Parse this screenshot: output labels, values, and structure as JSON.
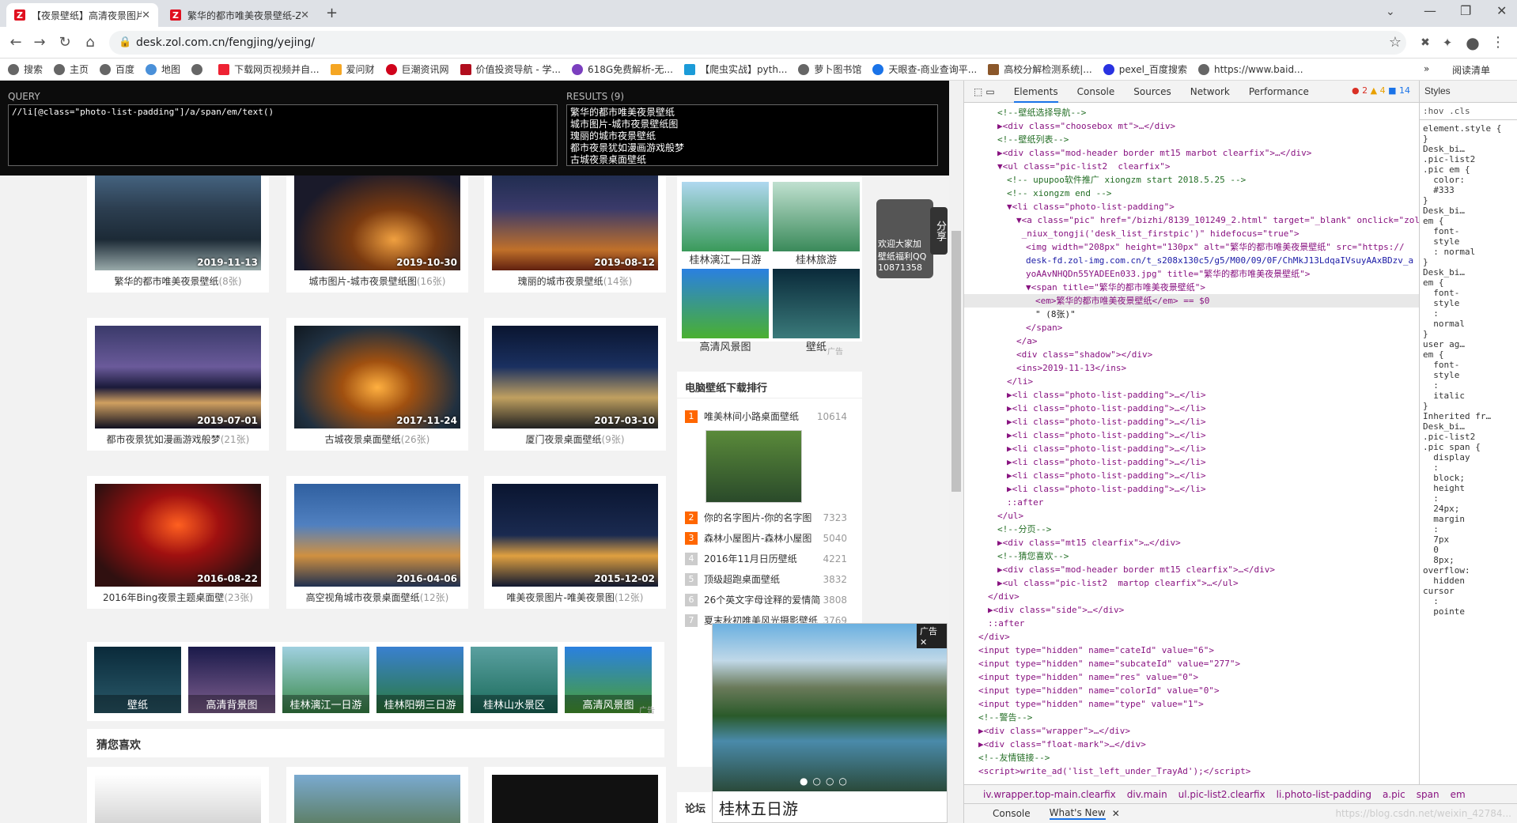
{
  "tabs": [
    {
      "title": "【夜景壁纸】高清夜景图片-ZOL",
      "active": true
    },
    {
      "title": "繁华的都市唯美夜景壁纸-ZOL桌",
      "active": false
    }
  ],
  "address": {
    "url": "desk.zol.com.cn/fengjing/yejing/"
  },
  "bookmarks": [
    "搜索",
    "主页",
    "百度",
    "地图",
    "",
    "下载网页视频并自...",
    "爱问财",
    "巨潮资讯网",
    "价值投资导航 - 学...",
    "618G免费解析-无...",
    "【爬虫实战】pyth...",
    "萝卜图书馆",
    "天眼查-商业查询平...",
    "高校分解检测系统|...",
    "pexel_百度搜索",
    "https://www.baid..."
  ],
  "bookmarks_more": "»",
  "reading_list": "阅读清单",
  "xpath_helper": {
    "query_label": "QUERY",
    "query": "//li[@class=\"photo-list-padding\"]/a/span/em/text()",
    "results_label": "RESULTS (9)",
    "results": [
      "繁华的都市唯美夜景壁纸",
      "城市图片-城市夜景壁纸图",
      "瑰丽的城市夜景壁纸",
      "都市夜景犹如漫画游戏般梦",
      "古城夜景桌面壁纸"
    ]
  },
  "photos": [
    {
      "title": "繁华的都市唯美夜景壁纸",
      "count": "(8张)",
      "date": "2019-11-13"
    },
    {
      "title": "城市图片-城市夜景壁纸图",
      "count": "(16张)",
      "date": "2019-10-30"
    },
    {
      "title": "瑰丽的城市夜景壁纸",
      "count": "(14张)",
      "date": "2019-08-12"
    },
    {
      "title": "都市夜景犹如漫画游戏般梦",
      "count": "(21张)",
      "date": "2019-07-01"
    },
    {
      "title": "古城夜景桌面壁纸",
      "count": "(26张)",
      "date": "2017-11-24"
    },
    {
      "title": "厦门夜景桌面壁纸",
      "count": "(9张)",
      "date": "2017-03-10"
    },
    {
      "title": "2016年Bing夜景主题桌面壁",
      "count": "(23张)",
      "date": "2016-08-22"
    },
    {
      "title": "高空视角城市夜景桌面壁纸",
      "count": "(12张)",
      "date": "2016-04-06"
    },
    {
      "title": "唯美夜景图片-唯美夜景图",
      "count": "(12张)",
      "date": "2015-12-02"
    }
  ],
  "strip": [
    "壁纸",
    "高清背景图",
    "桂林漓江一日游",
    "桂林阳朔三日游",
    "桂林山水景区",
    "高清风景图"
  ],
  "strip_ad": "广告",
  "guess_title": "猜您喜欢",
  "side_thumbs": [
    "桂林漓江一日游",
    "桂林旅游",
    "高清风景图",
    "壁纸"
  ],
  "side_ad_tag": "广告",
  "float_widget": {
    "share": "分享",
    "line1": "欢迎大家加",
    "line2": "壁纸福利QQ",
    "line3": "10871358"
  },
  "rank": {
    "title": "电脑壁纸下载排行",
    "items": [
      {
        "n": "1",
        "name": "唯美林间小路桌面壁纸",
        "count": "10614"
      },
      {
        "n": "2",
        "name": "你的名字图片-你的名字图",
        "count": "7323"
      },
      {
        "n": "3",
        "name": "森林小屋图片-森林小屋图",
        "count": "5040"
      },
      {
        "n": "4",
        "name": "2016年11月日历壁纸",
        "count": "4221"
      },
      {
        "n": "5",
        "name": "顶级超跑桌面壁纸",
        "count": "3832"
      },
      {
        "n": "6",
        "name": "26个英文字母诠释的爱情简",
        "count": "3808"
      },
      {
        "n": "7",
        "name": "夏末秋初唯美风光摄影壁纸",
        "count": "3769"
      }
    ]
  },
  "forum_title": "论坛",
  "popup": {
    "ad_label": "广告",
    "caption": "桂林五日游"
  },
  "devtools": {
    "tabs": [
      "Elements",
      "Console",
      "Sources",
      "Network",
      "Performance"
    ],
    "errors": "2",
    "warnings": "4",
    "messages": "14",
    "lines": [
      {
        "i": 3,
        "t": "<!--壁纸选择导航-->",
        "k": "cm"
      },
      {
        "i": 3,
        "t": "▶<div class=\"choosebox mt\">…</div>",
        "k": "tg"
      },
      {
        "i": 3,
        "t": "<!--壁纸列表-->",
        "k": "cm"
      },
      {
        "i": 3,
        "t": "▶<div class=\"mod-header border mt15 marbot clearfix\">…</div>",
        "k": "tg"
      },
      {
        "i": 3,
        "t": "▼<ul class=\"pic-list2  clearfix\">",
        "k": "tg"
      },
      {
        "i": 4,
        "t": "<!-- upupoo软件推广 xiongzm start 2018.5.25 -->",
        "k": "cm"
      },
      {
        "i": 4,
        "t": "<!-- xiongzm end -->",
        "k": "cm"
      },
      {
        "i": 4,
        "t": "▼<li class=\"photo-list-padding\">",
        "k": "tg"
      },
      {
        "i": 5,
        "t": "▼<a class=\"pic\" href=\"/bizhi/8139_101249_2.html\" target=\"_blank\" onclick=\"zol",
        "k": "tg"
      },
      {
        "i": 5,
        "t": " _niux_tongji('desk_list_firstpic')\" hidefocus=\"true\">",
        "k": "tg"
      },
      {
        "i": 6,
        "t": "<img width=\"208px\" height=\"130px\" alt=\"繁华的都市唯美夜景壁纸\" src=\"https://",
        "k": "tg"
      },
      {
        "i": 6,
        "t": "desk-fd.zol-img.com.cn/t_s208x130c5/g5/M00/09/0F/ChMkJ13LdqaIVsuyAAxBDzv_a",
        "k": "av"
      },
      {
        "i": 6,
        "t": "yoAAvNHQDn55YADEEn033.jpg\" title=\"繁华的都市唯美夜景壁纸\">",
        "k": "tg"
      },
      {
        "i": 6,
        "t": "▼<span title=\"繁华的都市唯美夜景壁纸\">",
        "k": "tg"
      },
      {
        "i": 7,
        "t": "<em>繁华的都市唯美夜景壁纸</em> == $0",
        "k": "tg",
        "sel": true
      },
      {
        "i": 7,
        "t": "\" (8张)\"",
        "k": "tx"
      },
      {
        "i": 6,
        "t": "</span>",
        "k": "tg"
      },
      {
        "i": 5,
        "t": "</a>",
        "k": "tg"
      },
      {
        "i": 5,
        "t": "<div class=\"shadow\"></div>",
        "k": "tg"
      },
      {
        "i": 5,
        "t": "<ins>2019-11-13</ins>",
        "k": "tg"
      },
      {
        "i": 4,
        "t": "</li>",
        "k": "tg"
      },
      {
        "i": 4,
        "t": "▶<li class=\"photo-list-padding\">…</li>",
        "k": "tg"
      },
      {
        "i": 4,
        "t": "▶<li class=\"photo-list-padding\">…</li>",
        "k": "tg"
      },
      {
        "i": 4,
        "t": "▶<li class=\"photo-list-padding\">…</li>",
        "k": "tg"
      },
      {
        "i": 4,
        "t": "▶<li class=\"photo-list-padding\">…</li>",
        "k": "tg"
      },
      {
        "i": 4,
        "t": "▶<li class=\"photo-list-padding\">…</li>",
        "k": "tg"
      },
      {
        "i": 4,
        "t": "▶<li class=\"photo-list-padding\">…</li>",
        "k": "tg"
      },
      {
        "i": 4,
        "t": "▶<li class=\"photo-list-padding\">…</li>",
        "k": "tg"
      },
      {
        "i": 4,
        "t": "▶<li class=\"photo-list-padding\">…</li>",
        "k": "tg"
      },
      {
        "i": 4,
        "t": "::after",
        "k": "tg"
      },
      {
        "i": 3,
        "t": "</ul>",
        "k": "tg"
      },
      {
        "i": 3,
        "t": "<!--分页-->",
        "k": "cm"
      },
      {
        "i": 3,
        "t": "▶<div class=\"mt15 clearfix\">…</div>",
        "k": "tg"
      },
      {
        "i": 3,
        "t": "<!--猜您喜欢-->",
        "k": "cm"
      },
      {
        "i": 3,
        "t": "▶<div class=\"mod-header border mt15 clearfix\">…</div>",
        "k": "tg"
      },
      {
        "i": 3,
        "t": "▶<ul class=\"pic-list2  martop clearfix\">…</ul>",
        "k": "tg"
      },
      {
        "i": 2,
        "t": "</div>",
        "k": "tg"
      },
      {
        "i": 2,
        "t": "▶<div class=\"side\">…</div>",
        "k": "tg"
      },
      {
        "i": 2,
        "t": "::after",
        "k": "tg"
      },
      {
        "i": 1,
        "t": "</div>",
        "k": "tg"
      },
      {
        "i": 1,
        "t": "<input type=\"hidden\" name=\"cateId\" value=\"6\">",
        "k": "tg"
      },
      {
        "i": 1,
        "t": "<input type=\"hidden\" name=\"subcateId\" value=\"277\">",
        "k": "tg"
      },
      {
        "i": 1,
        "t": "<input type=\"hidden\" name=\"res\" value=\"0\">",
        "k": "tg"
      },
      {
        "i": 1,
        "t": "<input type=\"hidden\" name=\"colorId\" value=\"0\">",
        "k": "tg"
      },
      {
        "i": 1,
        "t": "<input type=\"hidden\" name=\"type\" value=\"1\">",
        "k": "tg"
      },
      {
        "i": 1,
        "t": "<!--警告-->",
        "k": "cm"
      },
      {
        "i": 1,
        "t": "▶<div class=\"wrapper\">…</div>",
        "k": "tg"
      },
      {
        "i": 1,
        "t": "▶<div class=\"float-mark\">…</div>",
        "k": "tg"
      },
      {
        "i": 1,
        "t": "<!--友情链接-->",
        "k": "cm"
      },
      {
        "i": 1,
        "t": "<script>write_ad('list_left_under_TrayAd');</script>",
        "k": "tg"
      }
    ],
    "styles": {
      "tab": "Styles",
      "filter": ":hov .cls",
      "rules": [
        "element.style {",
        "}",
        "Desk_bi…",
        ".pic-list2",
        ".pic em {",
        "  color:",
        "  #333",
        "}",
        "Desk_bi…",
        "em {",
        "  font-",
        "  style",
        "  : normal",
        "}",
        "Desk_bi…",
        "em {",
        "  font-",
        "  style",
        "  :",
        "  normal",
        "}",
        "user ag…",
        "em {",
        "  font-",
        "  style",
        "  :",
        "  italic",
        "}",
        "Inherited fr…",
        "Desk_bi…",
        ".pic-list2",
        ".pic span {",
        "  display",
        "  :",
        "  block;",
        "  height",
        "  :",
        "  24px;",
        "  margin",
        "  :",
        "  7px",
        "  0",
        "  8px;",
        "overflow:",
        "  hidden",
        "cursor",
        "  :",
        "  pointe"
      ],
      "inherited": "Inherited fr…"
    },
    "breadcrumbs": [
      "iv.wrapper.top-main.clearfix",
      "div.main",
      "ul.pic-list2.clearfix",
      "li.photo-list-padding",
      "a.pic",
      "span",
      "em"
    ],
    "drawer_tabs": [
      "Console",
      "What's New"
    ],
    "watermark": "https://blog.csdn.net/weixin_42784..."
  }
}
